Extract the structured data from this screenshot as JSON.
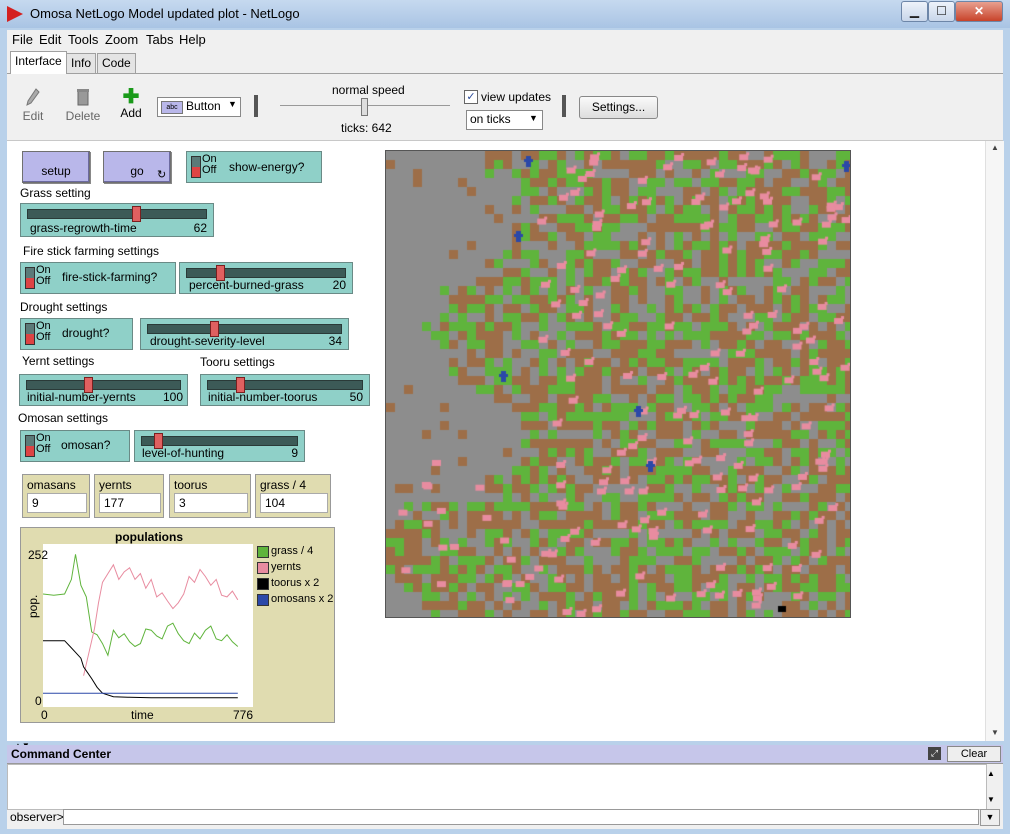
{
  "window": {
    "title": "Omosa NetLogo Model updated plot - NetLogo",
    "min": "▁",
    "max": "☐",
    "close": "✕"
  },
  "menu": [
    "File",
    "Edit",
    "Tools",
    "Zoom",
    "Tabs",
    "Help"
  ],
  "tabs": [
    "Interface",
    "Info",
    "Code"
  ],
  "toolbar": {
    "edit": "Edit",
    "delete": "Delete",
    "add": "Add",
    "widget_type": "Button",
    "speed_label": "normal speed",
    "ticks_label": "ticks: 642",
    "view_updates": "view updates",
    "update_mode": "on ticks",
    "settings": "Settings..."
  },
  "buttons": {
    "setup": "setup",
    "go": "go"
  },
  "switches": {
    "on": "On",
    "off": "Off",
    "show_energy": "show-energy?",
    "fire_stick": "fire-stick-farming?",
    "drought": "drought?",
    "omosan": "omosan?"
  },
  "labels": {
    "grass": "Grass setting",
    "fire": "Fire stick farming settings",
    "drought": "Drought settings",
    "yernt": "Yernt settings",
    "tooru": "Tooru settings",
    "omosan": "Omosan settings"
  },
  "sliders": [
    {
      "name": "grass-regrowth-time",
      "value": "62",
      "fraction": 0.62
    },
    {
      "name": "percent-burned-grass",
      "value": "20",
      "fraction": 0.2
    },
    {
      "name": "drought-severity-level",
      "value": "34",
      "fraction": 0.34
    },
    {
      "name": "initial-number-yernts",
      "value": "100",
      "fraction": 0.4
    },
    {
      "name": "initial-number-toorus",
      "value": "50",
      "fraction": 0.2
    },
    {
      "name": "level-of-hunting",
      "value": "9",
      "fraction": 0.09
    }
  ],
  "monitors": [
    {
      "label": "omasans",
      "value": "9"
    },
    {
      "label": "yernts",
      "value": "177"
    },
    {
      "label": "toorus",
      "value": "3"
    },
    {
      "label": "grass / 4",
      "value": "104"
    }
  ],
  "colors": {
    "grass": "#5fb43c",
    "dirt": "#9d6e48",
    "empty": "#8d8d8d",
    "yernt": "#e88ca0",
    "omosan": "#2b48a8"
  },
  "chart_data": {
    "type": "line",
    "title": "populations",
    "xlabel": "time",
    "ylabel": "pop.",
    "xlim": [
      0,
      776
    ],
    "ylim": [
      0,
      252
    ],
    "x_tick_labels": [
      "0",
      "776"
    ],
    "y_tick_labels": [
      "0",
      "252"
    ],
    "legend_position": "right",
    "series": [
      {
        "name": "grass / 4",
        "color": "#5fb43c",
        "points": [
          [
            0,
            180
          ],
          [
            40,
            178
          ],
          [
            80,
            180
          ],
          [
            105,
            205
          ],
          [
            120,
            248
          ],
          [
            140,
            195
          ],
          [
            160,
            175
          ],
          [
            180,
            115
          ],
          [
            200,
            110
          ],
          [
            220,
            95
          ],
          [
            240,
            75
          ],
          [
            260,
            118
          ],
          [
            280,
            105
          ],
          [
            300,
            112
          ],
          [
            320,
            98
          ],
          [
            340,
            90
          ],
          [
            360,
            95
          ],
          [
            380,
            120
          ],
          [
            400,
            118
          ],
          [
            420,
            108
          ],
          [
            440,
            103
          ],
          [
            460,
            125
          ],
          [
            480,
            130
          ],
          [
            500,
            112
          ],
          [
            520,
            100
          ],
          [
            540,
            95
          ],
          [
            560,
            113
          ],
          [
            580,
            103
          ],
          [
            600,
            118
          ],
          [
            620,
            125
          ],
          [
            640,
            103
          ],
          [
            660,
            100
          ],
          [
            680,
            110
          ],
          [
            700,
            98
          ],
          [
            720,
            90
          ]
        ]
      },
      {
        "name": "yernts",
        "color": "#e88ca0",
        "points": [
          [
            150,
            40
          ],
          [
            170,
            80
          ],
          [
            190,
            120
          ],
          [
            205,
            165
          ],
          [
            220,
            200
          ],
          [
            240,
            215
          ],
          [
            260,
            230
          ],
          [
            280,
            205
          ],
          [
            300,
            218
          ],
          [
            320,
            225
          ],
          [
            340,
            205
          ],
          [
            360,
            215
          ],
          [
            380,
            190
          ],
          [
            400,
            205
          ],
          [
            420,
            175
          ],
          [
            440,
            182
          ],
          [
            460,
            168
          ],
          [
            480,
            155
          ],
          [
            500,
            165
          ],
          [
            520,
            180
          ],
          [
            540,
            210
          ],
          [
            560,
            200
          ],
          [
            580,
            222
          ],
          [
            600,
            210
          ],
          [
            620,
            195
          ],
          [
            640,
            205
          ],
          [
            660,
            178
          ],
          [
            680,
            175
          ],
          [
            700,
            185
          ],
          [
            720,
            170
          ]
        ]
      },
      {
        "name": "toorus x 2",
        "color": "#000000",
        "points": [
          [
            0,
            100
          ],
          [
            80,
            100
          ],
          [
            100,
            90
          ],
          [
            120,
            80
          ],
          [
            140,
            70
          ],
          [
            150,
            55
          ],
          [
            165,
            45
          ],
          [
            180,
            35
          ],
          [
            200,
            20
          ],
          [
            220,
            10
          ],
          [
            260,
            4
          ],
          [
            320,
            3
          ],
          [
            400,
            2
          ],
          [
            500,
            2
          ],
          [
            600,
            2
          ],
          [
            720,
            2
          ]
        ]
      },
      {
        "name": "omosans x 2",
        "color": "#2b48a8",
        "points": [
          [
            0,
            10
          ],
          [
            720,
            10
          ]
        ]
      }
    ]
  },
  "command_center": {
    "title": "Command Center",
    "clear": "Clear",
    "prompt": "observer>"
  }
}
